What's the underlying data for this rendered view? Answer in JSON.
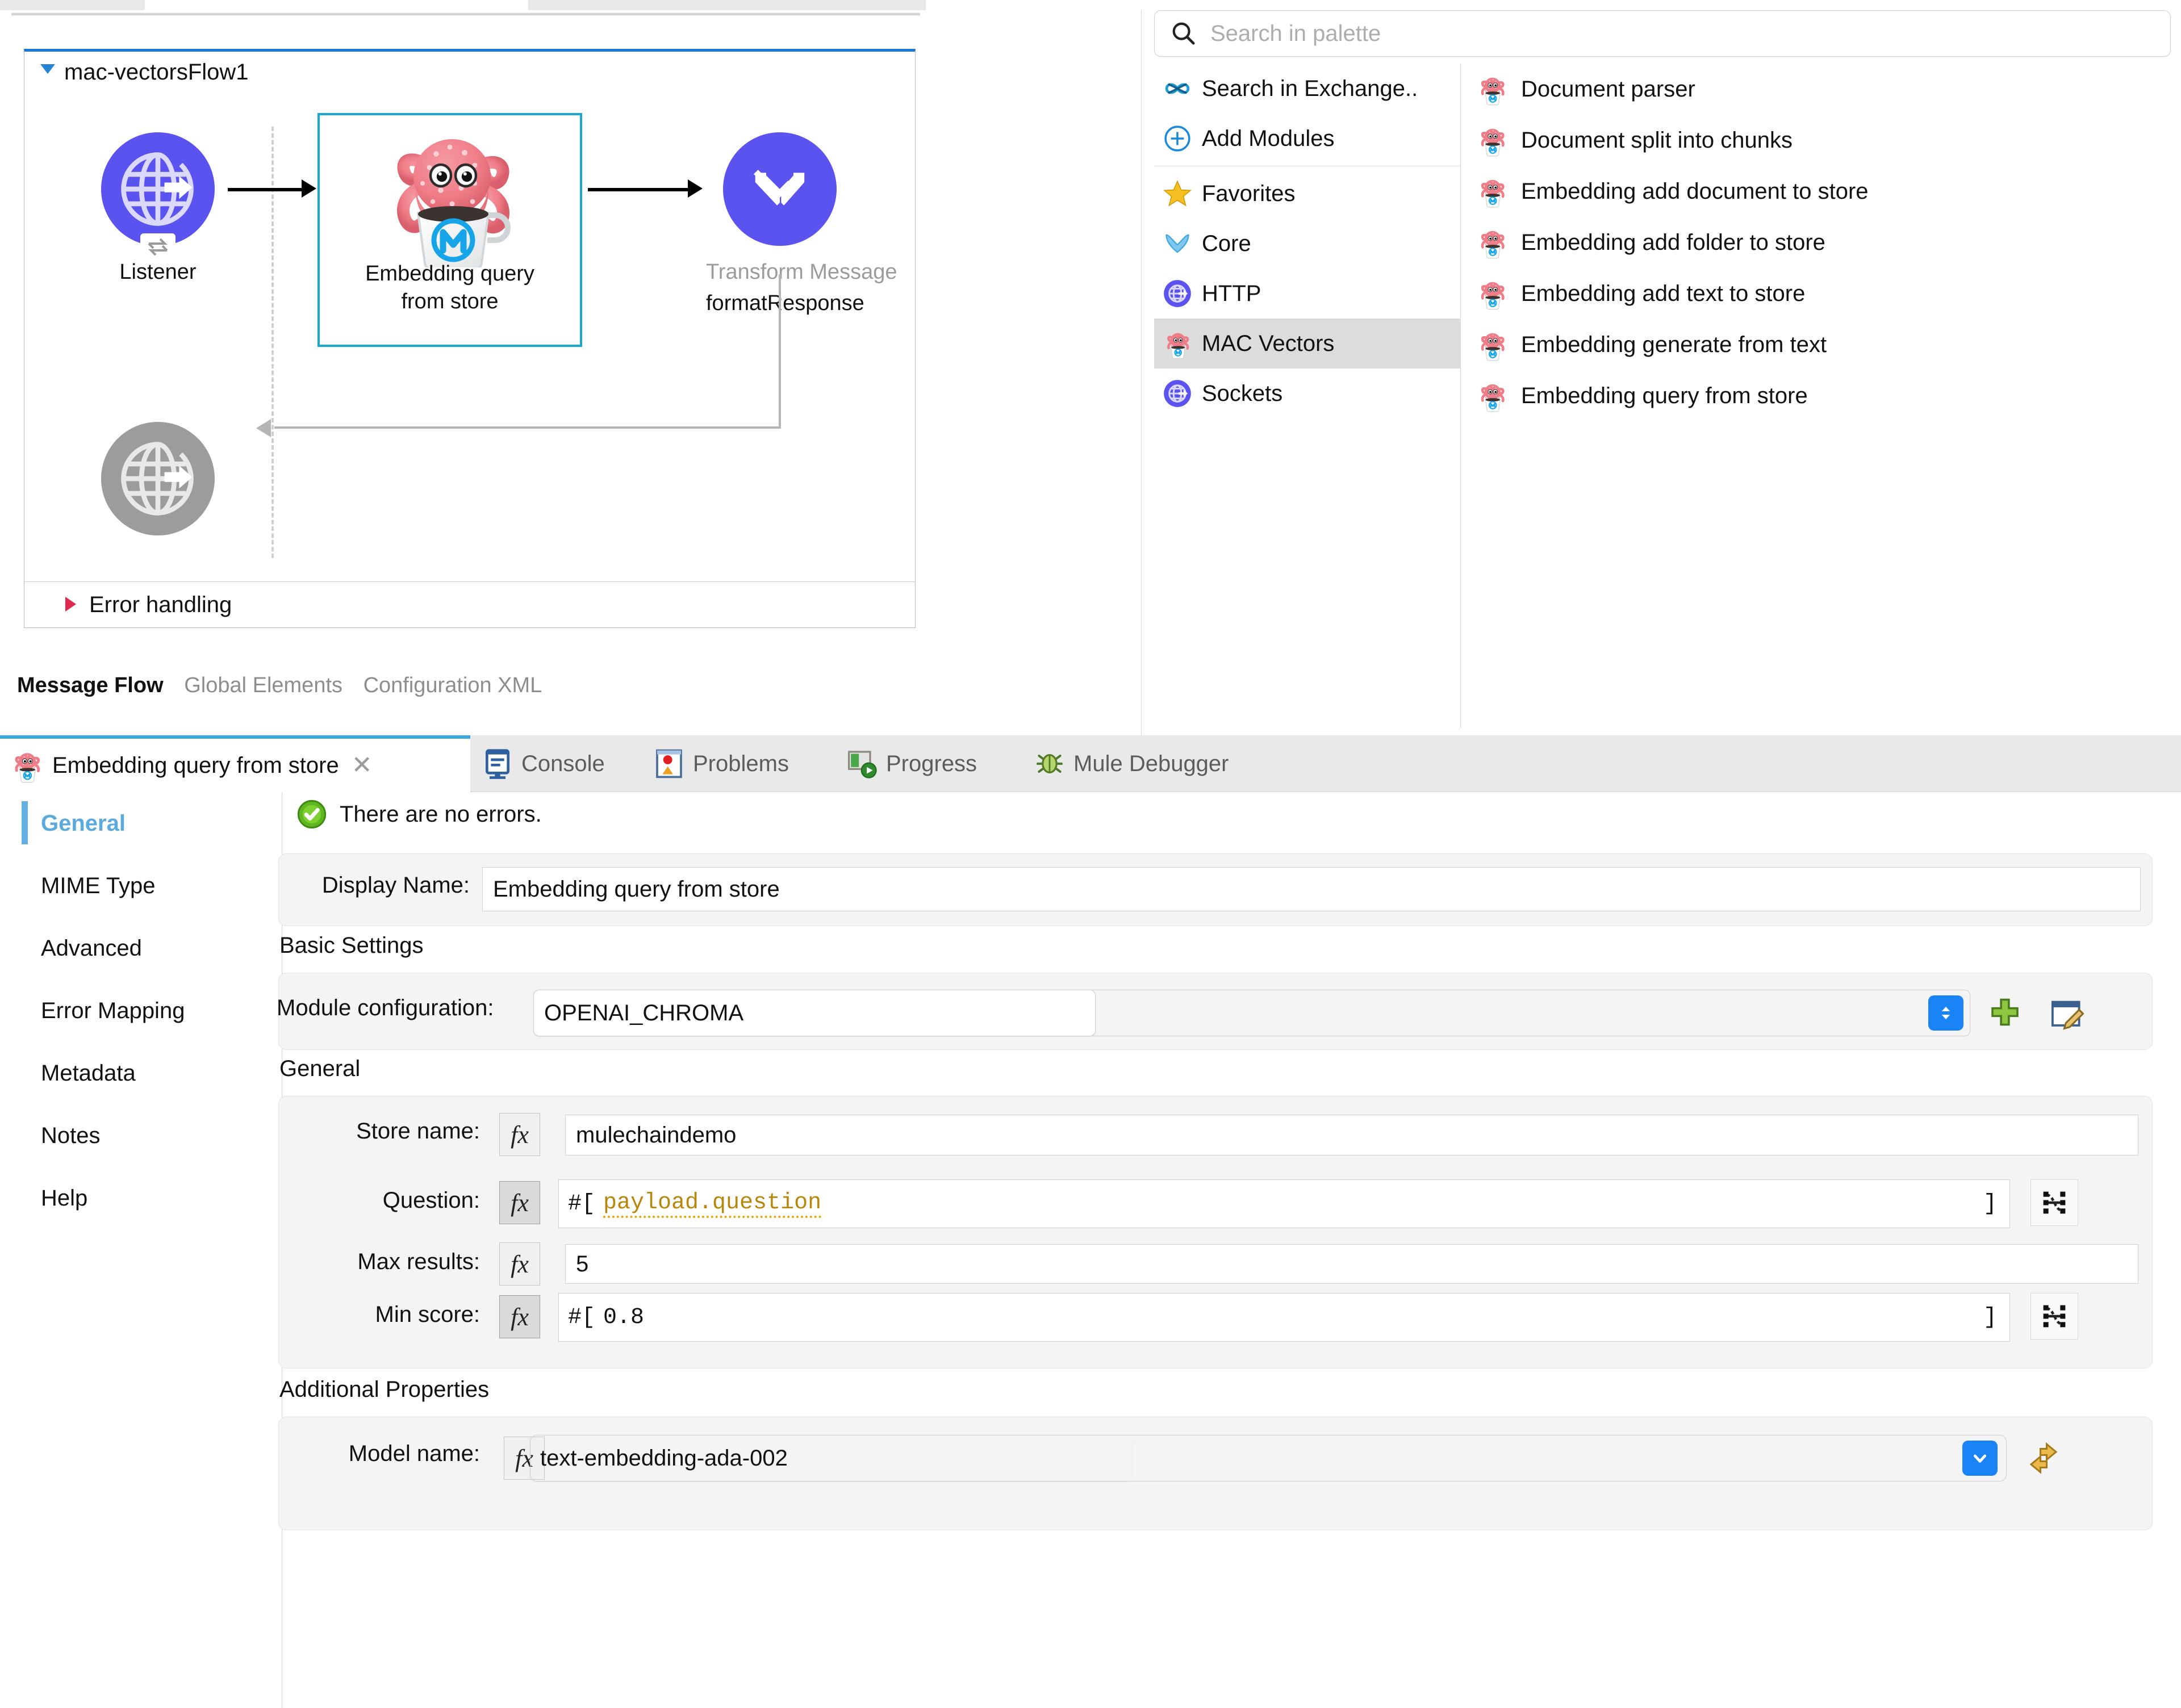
{
  "canvas": {
    "flow_name": "mac-vectorsFlow1",
    "nodes": [
      {
        "label_line1": "Listener",
        "label_line2": "",
        "icon": "http-listener-icon"
      },
      {
        "label_line1": "Embedding query",
        "label_line2": "from store",
        "icon": "mac-vectors-octopus-icon"
      },
      {
        "label_line1": "Transform Message",
        "label_line2": "formatResponse",
        "icon": "transform-message-icon"
      }
    ],
    "error_handling_label": "Error handling",
    "tabs": [
      {
        "label": "Message Flow",
        "active": true
      },
      {
        "label": "Global Elements",
        "active": false
      },
      {
        "label": "Configuration XML",
        "active": false
      }
    ]
  },
  "palette": {
    "search_placeholder": "Search in palette",
    "search_value": "",
    "categories": [
      {
        "label": "Search in Exchange..",
        "icon": "exchange-infinity-icon",
        "selected": false
      },
      {
        "label": "Add Modules",
        "icon": "plus-circle-icon",
        "selected": false
      },
      {
        "label": "Favorites",
        "icon": "star-icon",
        "selected": false
      },
      {
        "label": "Core",
        "icon": "mule-core-icon",
        "selected": false
      },
      {
        "label": "HTTP",
        "icon": "http-globe-icon",
        "selected": false
      },
      {
        "label": "MAC Vectors",
        "icon": "mac-vectors-octopus-icon",
        "selected": true
      },
      {
        "label": "Sockets",
        "icon": "sockets-globe-icon",
        "selected": false
      }
    ],
    "operations": [
      {
        "label": "Document parser",
        "icon": "mac-vectors-octopus-icon"
      },
      {
        "label": "Document split into chunks",
        "icon": "mac-vectors-octopus-icon"
      },
      {
        "label": "Embedding add document to store",
        "icon": "mac-vectors-octopus-icon"
      },
      {
        "label": "Embedding add folder to store",
        "icon": "mac-vectors-octopus-icon"
      },
      {
        "label": "Embedding add text to store",
        "icon": "mac-vectors-octopus-icon"
      },
      {
        "label": "Embedding generate from text",
        "icon": "mac-vectors-octopus-icon"
      },
      {
        "label": "Embedding query from store",
        "icon": "mac-vectors-octopus-icon"
      }
    ]
  },
  "bottom": {
    "active_tab_label": "Embedding query from store",
    "view_tabs": [
      {
        "label": "Console",
        "icon": "console-icon"
      },
      {
        "label": "Problems",
        "icon": "problems-icon"
      },
      {
        "label": "Progress",
        "icon": "progress-icon"
      },
      {
        "label": "Mule Debugger",
        "icon": "mule-debugger-icon"
      }
    ]
  },
  "properties": {
    "nav": [
      {
        "label": "General",
        "active": true
      },
      {
        "label": "MIME Type",
        "active": false
      },
      {
        "label": "Advanced",
        "active": false
      },
      {
        "label": "Error Mapping",
        "active": false
      },
      {
        "label": "Metadata",
        "active": false
      },
      {
        "label": "Notes",
        "active": false
      },
      {
        "label": "Help",
        "active": false
      }
    ],
    "status_message": "There are no errors.",
    "display_name_label": "Display Name:",
    "display_name_value": "Embedding query from store",
    "basic_settings_title": "Basic Settings",
    "module_config_label": "Module configuration:",
    "module_config_value": "OPENAI_CHROMA",
    "general_title": "General",
    "fields": [
      {
        "label": "Store name:",
        "value": "mulechaindemo",
        "expression": false
      },
      {
        "label": "Question:",
        "value": "payload.question",
        "expression": true,
        "prefix": "#[",
        "suffix": "]"
      },
      {
        "label": "Max results:",
        "value": "5",
        "expression": false
      },
      {
        "label": "Min score:",
        "value": "0.8",
        "expression": true,
        "prefix": "#[",
        "suffix": "]"
      }
    ],
    "additional_properties_title": "Additional Properties",
    "model_name_label": "Model name:",
    "model_name_value": "text-embedding-ada-002"
  },
  "colors": {
    "accent_blue": "#3ba7e0",
    "mule_purple": "#5b53ef",
    "selection_cyan": "#17a9d4",
    "error_red": "#e0294c",
    "expression_amber": "#b8860b"
  }
}
